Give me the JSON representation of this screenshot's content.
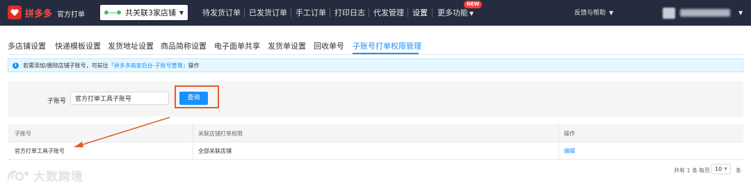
{
  "topbar": {
    "brand": "拼多多",
    "product": "官方打单",
    "shop_selector": "共关联3家店铺",
    "nav": [
      {
        "label": "待发货订单"
      },
      {
        "label": "已发货订单"
      },
      {
        "label": "手工订单"
      },
      {
        "label": "打印日志"
      },
      {
        "label": "代发管理"
      },
      {
        "label": "设置"
      },
      {
        "label": "更多功能"
      }
    ],
    "new_badge": "NEW",
    "help": "反馈与帮助"
  },
  "tabs": [
    {
      "label": "多店铺设置"
    },
    {
      "label": "快递模板设置"
    },
    {
      "label": "发货地址设置"
    },
    {
      "label": "商品简称设置"
    },
    {
      "label": "电子面单共享"
    },
    {
      "label": "发货单设置"
    },
    {
      "label": "回收单号"
    },
    {
      "label": "子账号打单权限管理",
      "active": true
    }
  ],
  "alert": {
    "prefix": "若需添加/删除店铺子账号，可前往",
    "link": "「拼多多商家后台-子账号管理」",
    "suffix": "操作"
  },
  "search": {
    "label": "子账号",
    "value": "官方打单工具子账号",
    "button": "查询"
  },
  "table": {
    "columns": [
      "子账号",
      "关联店铺打单权限",
      "操作"
    ],
    "rows": [
      {
        "account": "官方打单工具子账号",
        "permission": "全部关联店铺",
        "action": "编辑"
      }
    ]
  },
  "pagination": {
    "total_prefix": "共有",
    "total": "1",
    "total_suffix": "条",
    "per_page_label": "每页",
    "page_size": "10",
    "page_size_suffix": "条"
  },
  "watermark": "大数跨境",
  "colors": {
    "topbar_bg": "#262c3f",
    "brand_red": "#e02e24",
    "accent": "#1890ff",
    "annotation": "#e55a2b"
  }
}
